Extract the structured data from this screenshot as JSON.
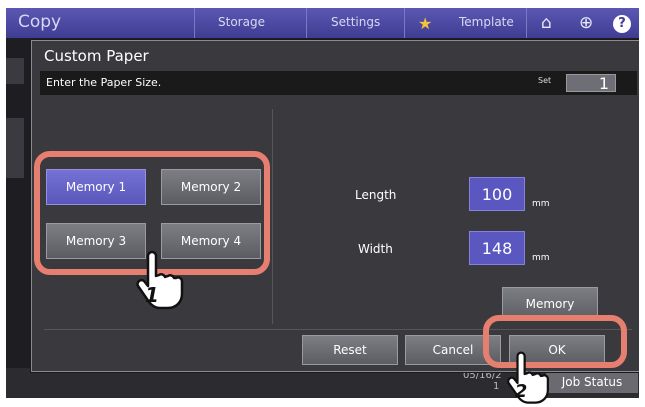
{
  "header": {
    "app_title": "Copy",
    "tabs": [
      "Storage",
      "Settings",
      "Template"
    ],
    "icons": [
      "star-icon",
      "home-icon",
      "globe-icon",
      "help-icon"
    ]
  },
  "dialog": {
    "title": "Custom Paper",
    "instruction": "Enter the Paper Size.",
    "set_label": "Set",
    "set_value": "1",
    "memory_buttons": [
      "Memory 1",
      "Memory 2",
      "Memory 3",
      "Memory 4"
    ],
    "selected_memory": "Memory 1",
    "length_label": "Length",
    "length_value": "100",
    "length_unit": "mm",
    "width_label": "Width",
    "width_value": "148",
    "width_unit": "mm",
    "memory_button": "Memory",
    "reset_button": "Reset",
    "cancel_button": "Cancel",
    "ok_button": "OK"
  },
  "footer": {
    "date_fragment": "05/16/2",
    "time_fragment": "1",
    "job_status": "Job Status"
  },
  "callouts": {
    "step1": "1",
    "step2": "2",
    "highlight_color": "#e77f71"
  }
}
